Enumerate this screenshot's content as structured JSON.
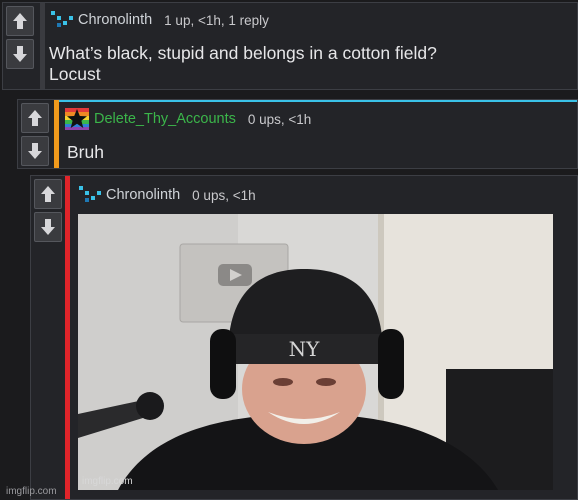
{
  "comments": [
    {
      "author": "Chronolinth",
      "meta": "1 up, <1h, 1 reply",
      "text_lines": [
        "What’s black, stupid and belongs in a cotton field?",
        "Locust"
      ],
      "author_color": "#cfd3d8",
      "accent_color": "#3ac2e8"
    },
    {
      "author": "Delete_Thy_Accounts",
      "meta": "0 ups, <1h",
      "text": "Bruh",
      "author_color": "#3bb54a",
      "accent_color": "#f19a1c"
    },
    {
      "author": "Chronolinth",
      "meta": "0 ups, <1h",
      "author_color": "#cfd3d8",
      "accent_color": "#e0242a",
      "image_watermark": "imgflip.com"
    }
  ],
  "site_watermark": "imgflip.com",
  "icons": {
    "upvote": "arrow-up-icon",
    "downvote": "arrow-down-icon",
    "avatar_chronolinth": "pixel-logo-icon",
    "avatar_delete_thy_accounts": "rainbow-star-icon"
  },
  "colors": {
    "background": "#1b1b1d",
    "panel": "#232428",
    "border": "#3c3e44",
    "text": "#e6e6e8",
    "meta": "#c9c9cc"
  }
}
